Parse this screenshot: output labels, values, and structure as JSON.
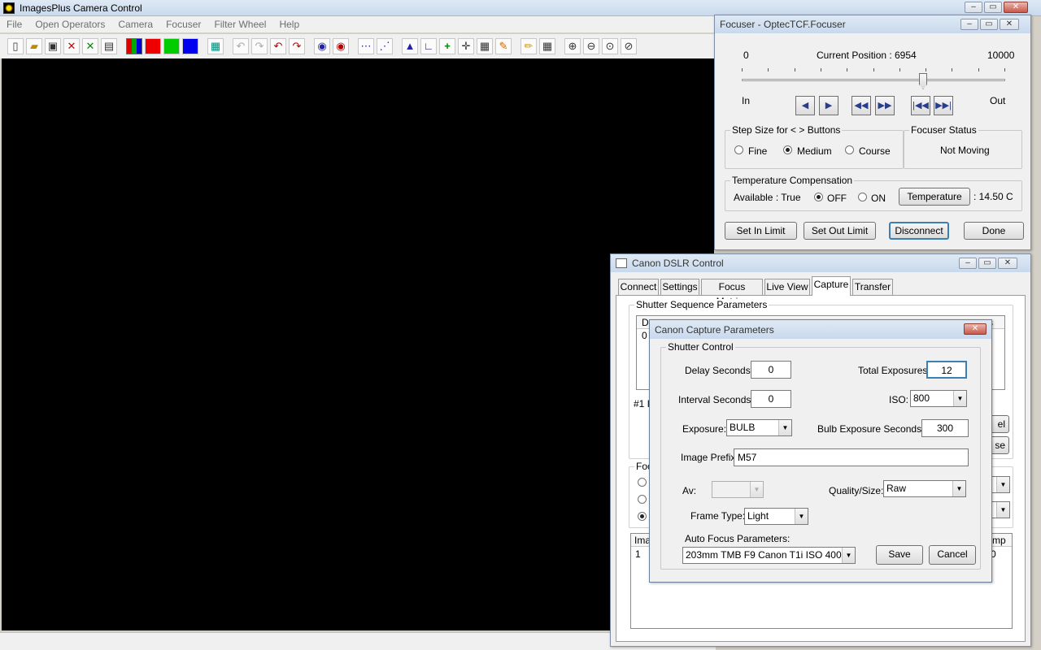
{
  "app": {
    "title": "ImagesPlus Camera Control",
    "menu": [
      "File",
      "Open Operators",
      "Camera",
      "Focuser",
      "Filter Wheel",
      "Help"
    ]
  },
  "focuser": {
    "title": "Focuser - OptecTCF.Focuser",
    "min": "0",
    "max": "10000",
    "current_label": "Current Position :",
    "current_value": "6954",
    "position_fraction": 0.6954,
    "in_label": "In",
    "out_label": "Out",
    "step_group": "Step Size for < > Buttons",
    "step_fine": "Fine",
    "step_medium": "Medium",
    "step_course": "Course",
    "status_group": "Focuser Status",
    "status_value": "Not Moving",
    "temp_group": "Temperature Compensation",
    "available": "Available : True",
    "off": "OFF",
    "on": "ON",
    "temperature_btn": "Temperature",
    "temperature_value": ": 14.50 C",
    "set_in_limit": "Set In Limit",
    "set_out_limit": "Set Out Limit",
    "disconnect": "Disconnect",
    "done": "Done"
  },
  "dslr": {
    "title": "Canon DSLR Control",
    "tabs": [
      "Connect",
      "Settings",
      "Focus Metrics",
      "Live View",
      "Capture",
      "Transfer"
    ],
    "seq_group": "Shutter Sequence Parameters",
    "seq_header_left": "D",
    "seq_header_right": "s",
    "seq_row_left": "0",
    "hash_label": "#1 I",
    "partial_btn_1": "el",
    "partial_btn_2": "se",
    "focus_group": "Foc",
    "img_header_left": "Ima",
    "img_header_right": "mp",
    "img_row_left": "1",
    "img_row_right": "0"
  },
  "capture": {
    "title": "Canon Capture Parameters",
    "group": "Shutter Control",
    "delay_label": "Delay Seconds:",
    "delay_value": "0",
    "total_label": "Total Exposures:",
    "total_value": "12",
    "interval_label": "Interval Seconds:",
    "interval_value": "0",
    "iso_label": "ISO:",
    "iso_value": "800",
    "exposure_label": "Exposure:",
    "exposure_value": "BULB",
    "bulb_label": "Bulb Exposure Seconds :",
    "bulb_value": "300",
    "prefix_label": "Image Prefix:",
    "prefix_value": "M57",
    "av_label": "Av:",
    "quality_label": "Quality/Size:",
    "quality_value": "Raw",
    "frame_label": "Frame Type:",
    "frame_value": "Light",
    "af_label": "Auto Focus Parameters:",
    "af_value": "203mm TMB F9 Canon T1i ISO 400",
    "save": "Save",
    "cancel": "Cancel"
  },
  "colors": {
    "title_bar": "#d3e1f1",
    "canvas": "#000000",
    "close": "#c9584a"
  }
}
